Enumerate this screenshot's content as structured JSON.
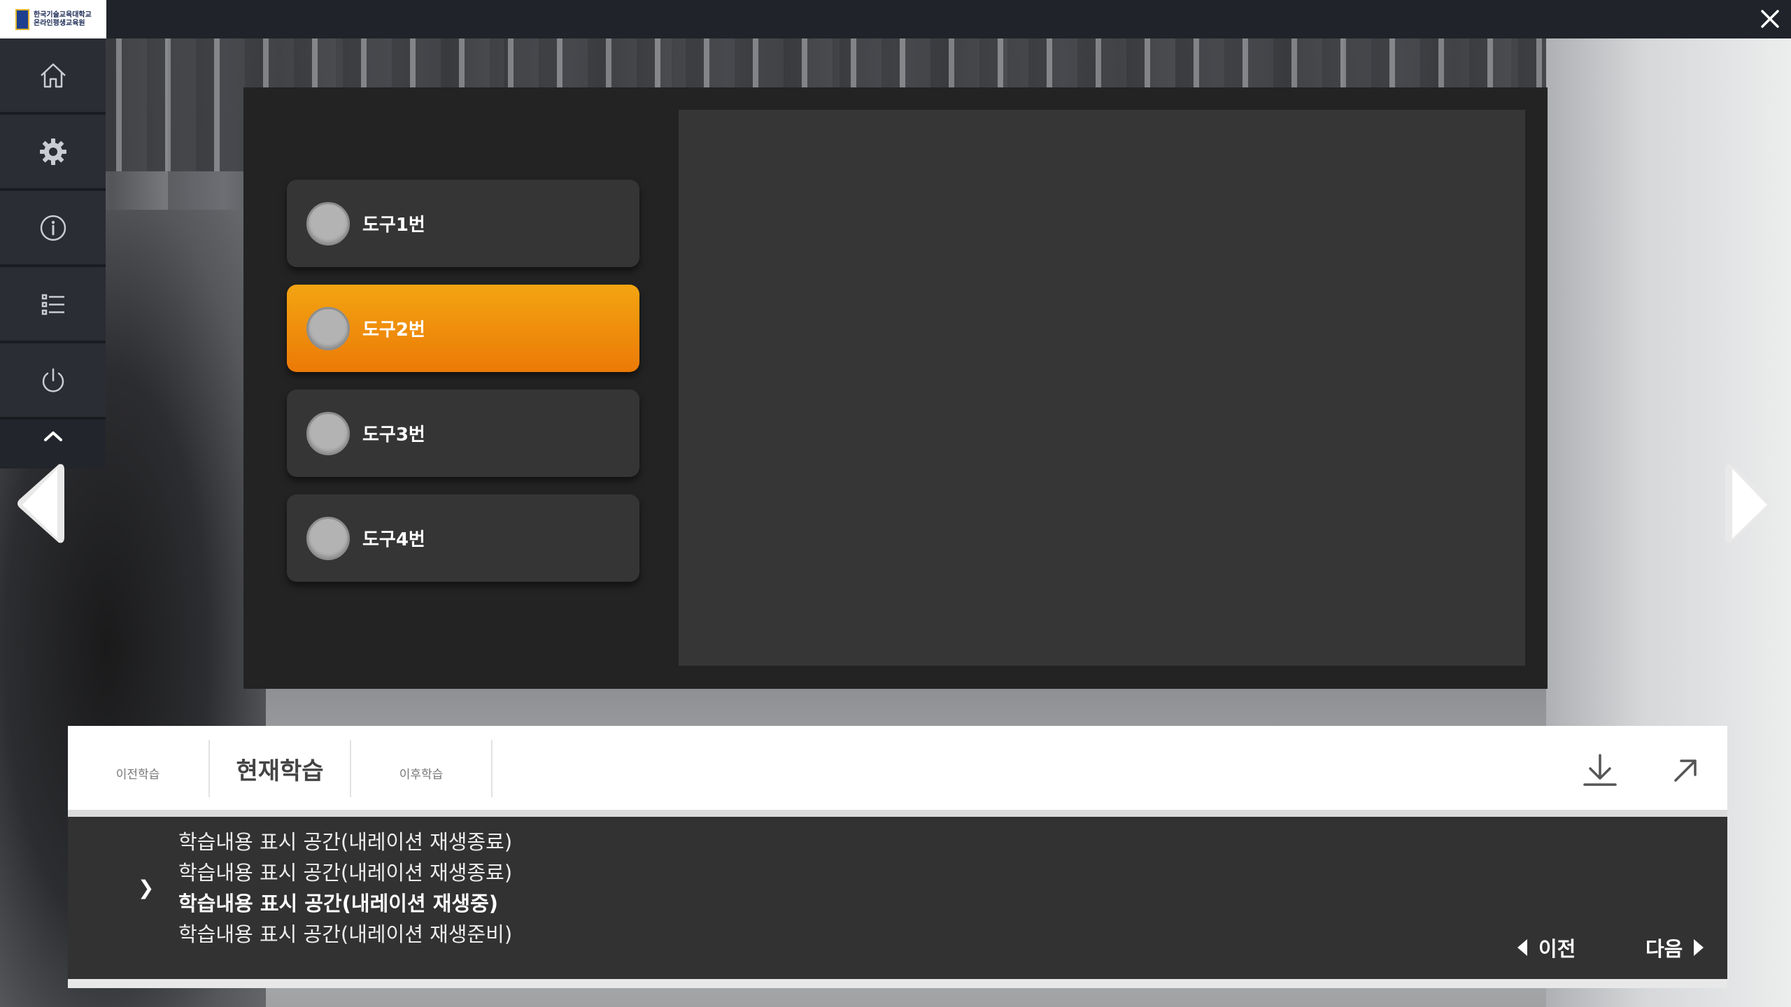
{
  "app": {
    "logo_text": "한국기술교육대학교\n온라인평생교육원",
    "close_icon": "close-icon"
  },
  "sidebar": {
    "items": [
      {
        "icon": "home-icon"
      },
      {
        "icon": "gear-icon"
      },
      {
        "icon": "info-icon"
      },
      {
        "icon": "list-icon"
      },
      {
        "icon": "power-icon"
      }
    ],
    "collapse_icon": "chevron-up-icon"
  },
  "tools": {
    "items": [
      {
        "label": "도구1번",
        "active": false
      },
      {
        "label": "도구2번",
        "active": true
      },
      {
        "label": "도구3번",
        "active": false
      },
      {
        "label": "도구4번",
        "active": false
      }
    ],
    "accent_color": "#f08a0c"
  },
  "learning": {
    "tabs": {
      "prev": "이전학습",
      "current": "현재학습",
      "next": "이후학습"
    },
    "lines": [
      {
        "text": "학습내용 표시 공간(내레이션 재생종료)",
        "state": "done"
      },
      {
        "text": "학습내용 표시 공간(내레이션 재생종료)",
        "state": "done"
      },
      {
        "text": "학습내용 표시 공간(내레이션 재생중)",
        "state": "playing"
      },
      {
        "text": "학습내용 표시 공간(내레이션 재생준비)",
        "state": "ready"
      }
    ],
    "playing_marker": "❯",
    "prev_label": "이전",
    "next_label": "다음"
  }
}
